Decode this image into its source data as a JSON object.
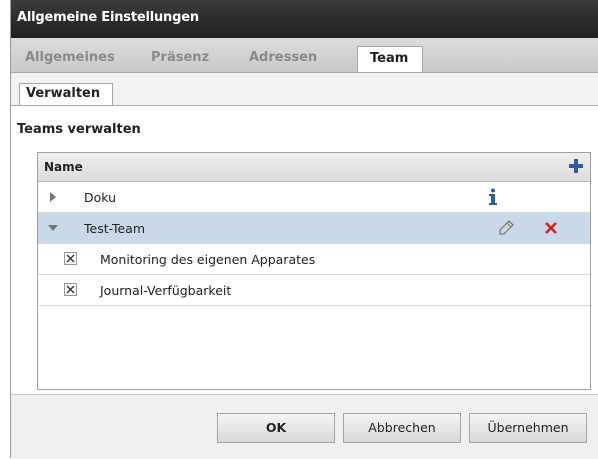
{
  "window": {
    "title": "Allgemeine Einstellungen"
  },
  "tabs": [
    {
      "label": "Allgemeines"
    },
    {
      "label": "Präsenz"
    },
    {
      "label": "Adressen"
    },
    {
      "label": "Team"
    }
  ],
  "subtab": {
    "label": "Verwalten"
  },
  "section": {
    "title": "Teams verwalten"
  },
  "list": {
    "header": "Name",
    "add_icon": "plus-icon",
    "rows": [
      {
        "label": "Doku",
        "icon": "info-icon"
      },
      {
        "label": "Test-Team",
        "icons": [
          "pencil-icon",
          "delete-icon"
        ]
      }
    ],
    "children": [
      {
        "label": "Monitoring des eigenen Apparates",
        "checked": true
      },
      {
        "label": "Journal-Verfügbarkeit",
        "checked": true
      }
    ]
  },
  "buttons": {
    "ok": "OK",
    "cancel": "Abbrechen",
    "apply": "Übernehmen"
  },
  "colors": {
    "titlebar": "#2b2b2b",
    "selected_row": "#cad9ea",
    "add": "#2f5aa8",
    "delete": "#d62020",
    "info": "#2f5aa8"
  }
}
